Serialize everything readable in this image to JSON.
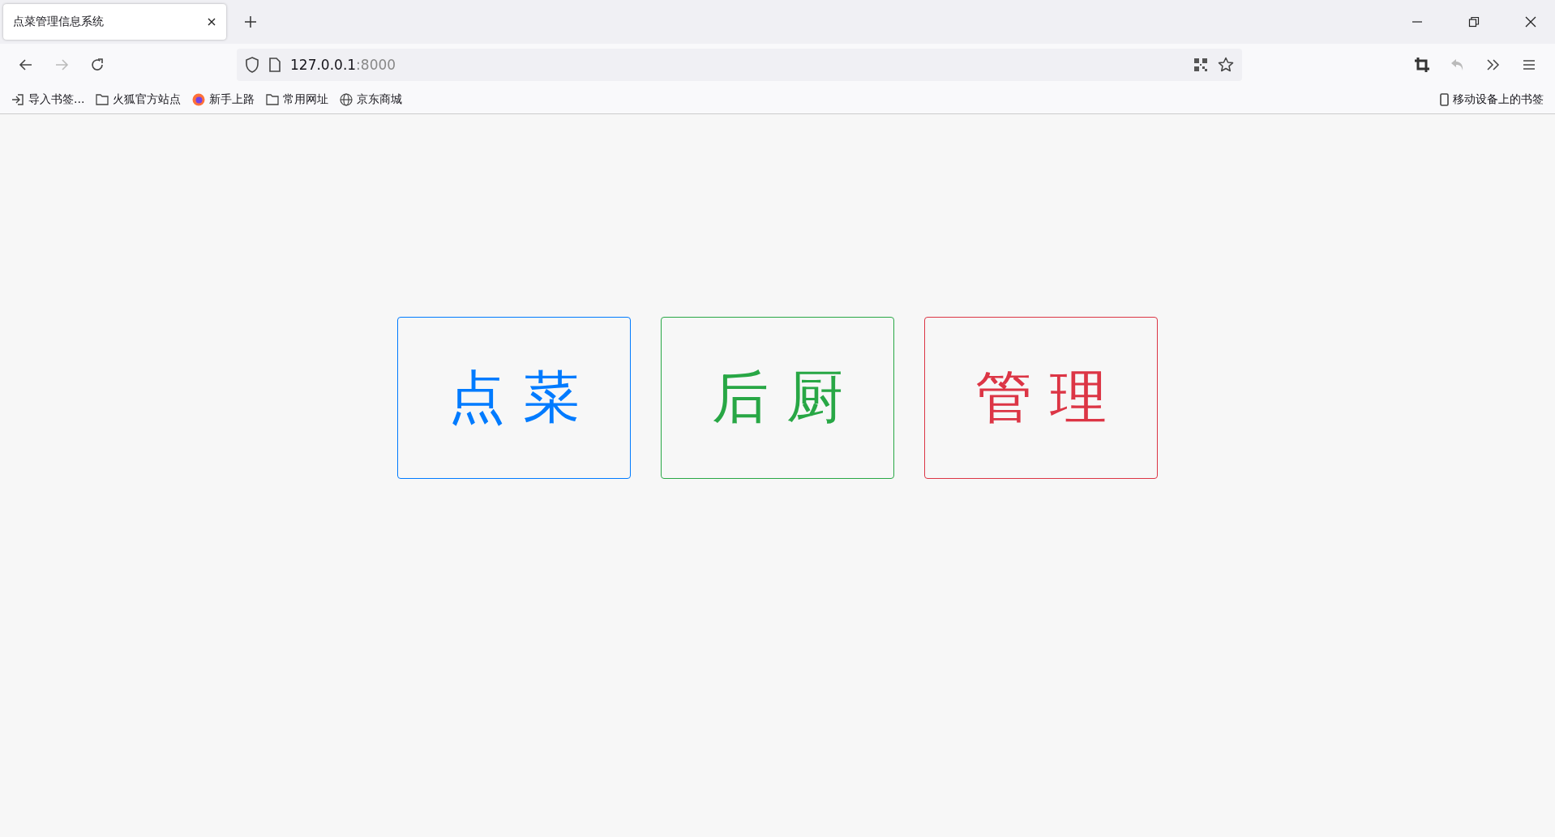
{
  "browser": {
    "tabs": [
      {
        "title": "点菜管理信息系统",
        "selected": true
      }
    ],
    "toolbar": {
      "back_disabled": false,
      "forward_disabled": true
    },
    "address_bar": {
      "host": "127.0.0.1",
      "port": ":8000"
    },
    "bookmarks": [
      {
        "label": "导入书签...",
        "kind": "import"
      },
      {
        "label": "火狐官方站点",
        "kind": "folder"
      },
      {
        "label": "新手上路",
        "kind": "firefox"
      },
      {
        "label": "常用网址",
        "kind": "folder"
      },
      {
        "label": "京东商城",
        "kind": "globe"
      }
    ],
    "mobile_bookmarks": "移动设备上的书签"
  },
  "page": {
    "buttons": [
      {
        "label": "点 菜",
        "color": "#007bff"
      },
      {
        "label": "后 厨",
        "color": "#28a745"
      },
      {
        "label": "管 理",
        "color": "#dc3545"
      }
    ]
  }
}
